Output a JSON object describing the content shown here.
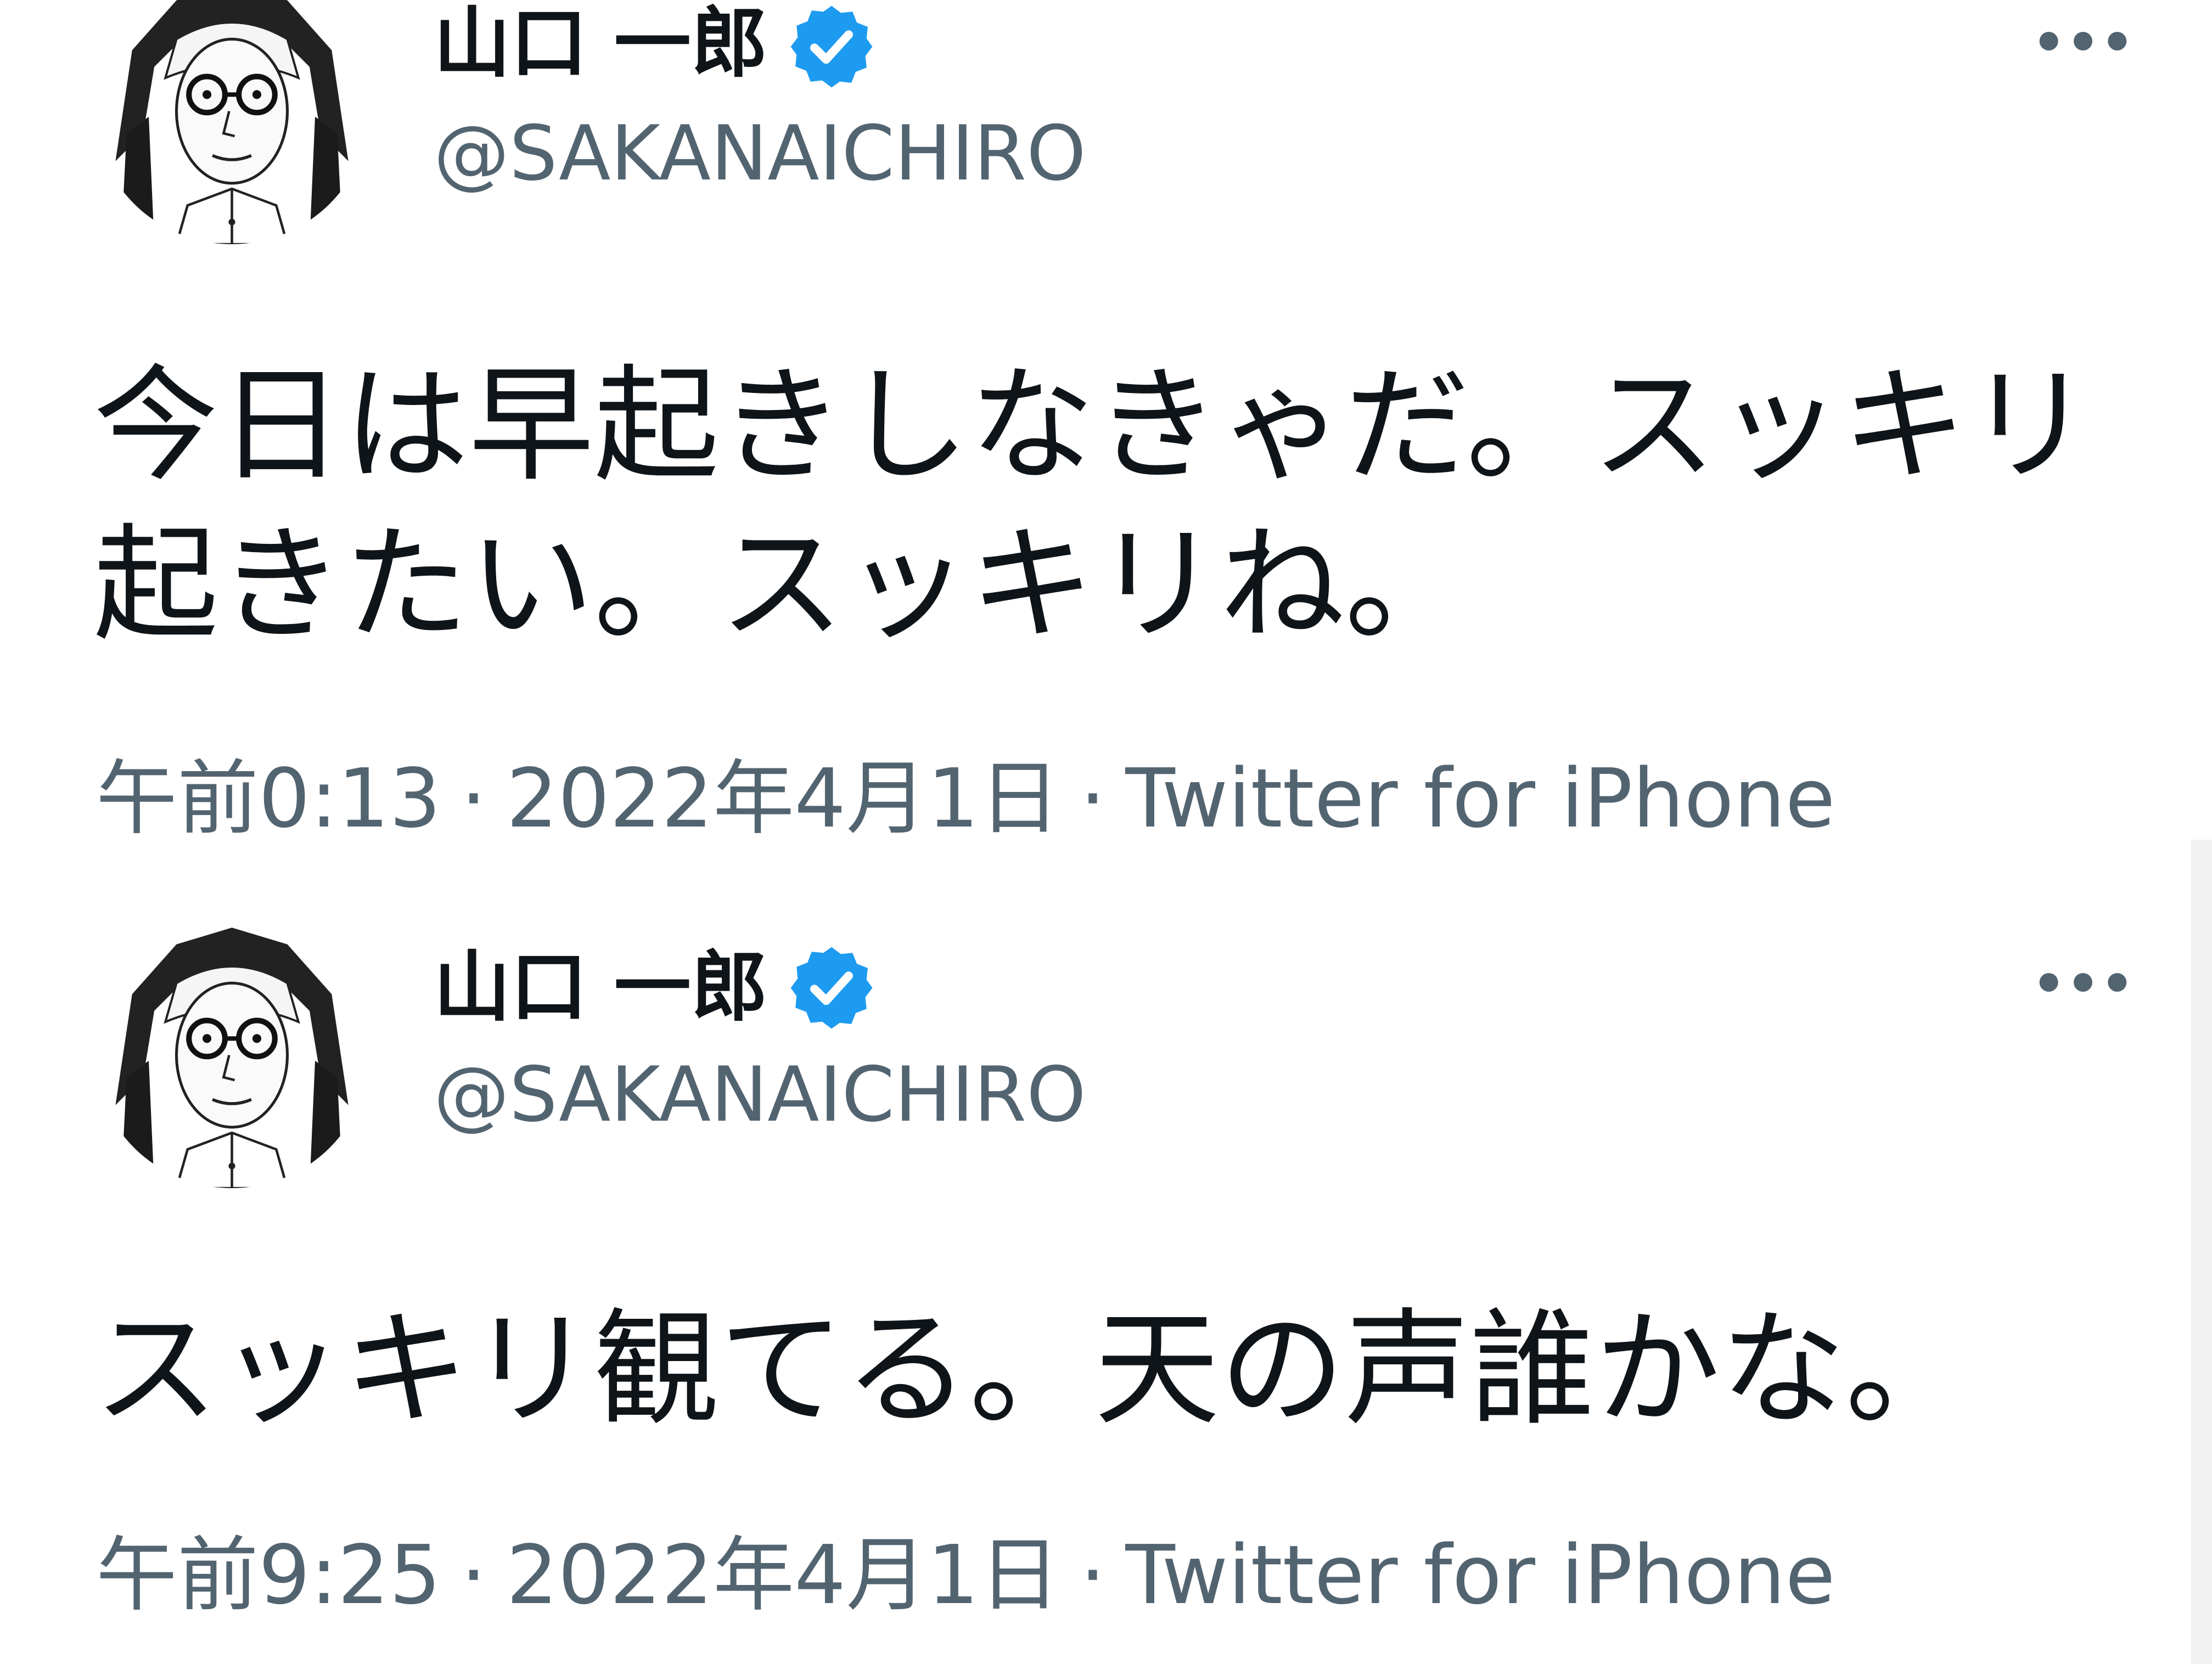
{
  "tweets": [
    {
      "display_name": "山口 一郎",
      "handle": "@SAKANAICHIRO",
      "text": "今日は早起きしなきゃだ。スッキリ起きたい。スッキリね。",
      "time": "午前0:13",
      "date": "2022年4月1日",
      "source": "Twitter for iPhone",
      "separator": "·"
    },
    {
      "display_name": "山口 一郎",
      "handle": "@SAKANAICHIRO",
      "text": "スッキリ観てる。天の声誰かな。",
      "time": "午前9:25",
      "date": "2022年4月1日",
      "source": "Twitter for iPhone",
      "separator": "·"
    }
  ],
  "colors": {
    "text_primary": "#0f1419",
    "text_secondary": "#536471",
    "verified_blue": "#1d9bf0"
  },
  "icons": {
    "verified": "verified-badge-icon",
    "more": "more-horizontal-icon"
  }
}
